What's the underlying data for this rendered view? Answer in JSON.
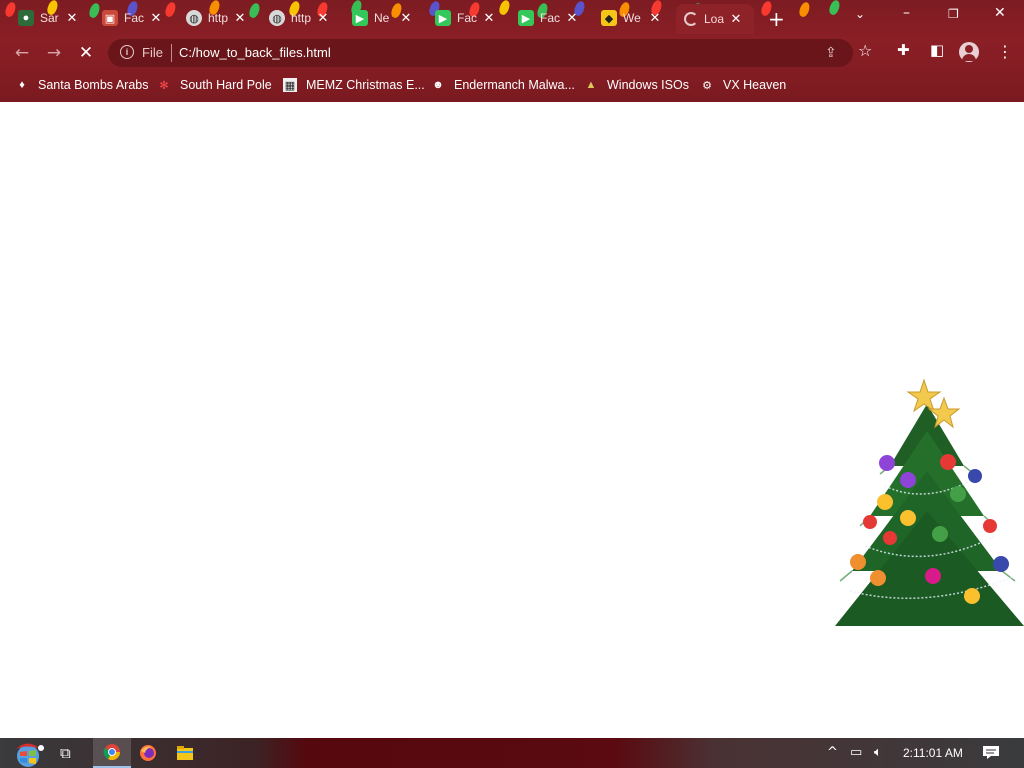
{
  "window": {
    "controls": {
      "minimize": "–",
      "restore": "❐",
      "close": "✕"
    }
  },
  "tabs": [
    {
      "title": "Sar",
      "icon": "santa-globe-icon",
      "color": "#2e6b3a"
    },
    {
      "title": "Fac",
      "icon": "gift-icon",
      "color": "#c94a3a"
    },
    {
      "title": "http",
      "icon": "globe-icon",
      "color": "#d9d9d9"
    },
    {
      "title": "http",
      "icon": "globe-icon",
      "color": "#d9d9d9"
    },
    {
      "title": "Ne",
      "icon": "facetime-icon",
      "color": "#34c759"
    },
    {
      "title": "Fac",
      "icon": "facetime-icon",
      "color": "#34c759"
    },
    {
      "title": "Fac",
      "icon": "facetime-icon",
      "color": "#34c759"
    },
    {
      "title": "We",
      "icon": "web-icon",
      "color": "#f5c518"
    },
    {
      "title": "Loa",
      "icon": "loading-icon",
      "color": "#e6c9cb",
      "active": true
    }
  ],
  "toolbar": {
    "back": "←",
    "forward": "→",
    "reload": "✕",
    "scheme": "File",
    "url": "C:/how_to_back_files.html"
  },
  "bookmarks": [
    {
      "label": "Santa Bombs Arabs",
      "icon": "santa-icon"
    },
    {
      "label": "South Hard Pole",
      "icon": "snowflake-icon"
    },
    {
      "label": "MEMZ Christmas E...",
      "icon": "memz-icon"
    },
    {
      "label": "Endermanch Malwa...",
      "icon": "raccoon-icon"
    },
    {
      "label": "Windows ISOs",
      "icon": "tree-icon"
    },
    {
      "label": "VX Heaven",
      "icon": "vx-icon"
    }
  ],
  "taskbar": {
    "clock": "2:11:01 AM",
    "apps": [
      "chrome-icon",
      "firefox-icon",
      "file-explorer-icon"
    ]
  },
  "colors": {
    "chrome_bg": "#8b1f26",
    "omnibox_bg": "#6a1519",
    "page_bg": "#ffffff"
  }
}
